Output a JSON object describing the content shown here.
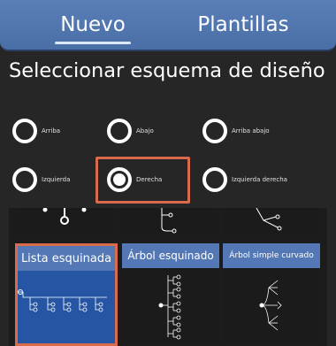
{
  "tabs": [
    {
      "label": "Nuevo",
      "active": true
    },
    {
      "label": "Plantillas",
      "active": false
    }
  ],
  "section_title": "Seleccionar esquema de diseño",
  "layout_options": [
    {
      "label": "Arriba",
      "selected": false
    },
    {
      "label": "Abajo",
      "selected": false
    },
    {
      "label": "Arriba abajo",
      "selected": false
    },
    {
      "label": "Izquierda",
      "selected": false
    },
    {
      "label": "Derecha",
      "selected": true
    },
    {
      "label": "Izquierda derecha",
      "selected": false
    }
  ],
  "templates": [
    {
      "label": "Lista esquinada",
      "selected": true
    },
    {
      "label": "Árbol esquinado",
      "selected": false
    },
    {
      "label": "Árbol simple curvado",
      "selected": false
    }
  ],
  "colors": {
    "tab_bar": "#4a6ea6",
    "background": "#262626",
    "highlight": "#d96b4d",
    "card_caption": "#5378b5",
    "selected_preview": "#2555a3"
  }
}
